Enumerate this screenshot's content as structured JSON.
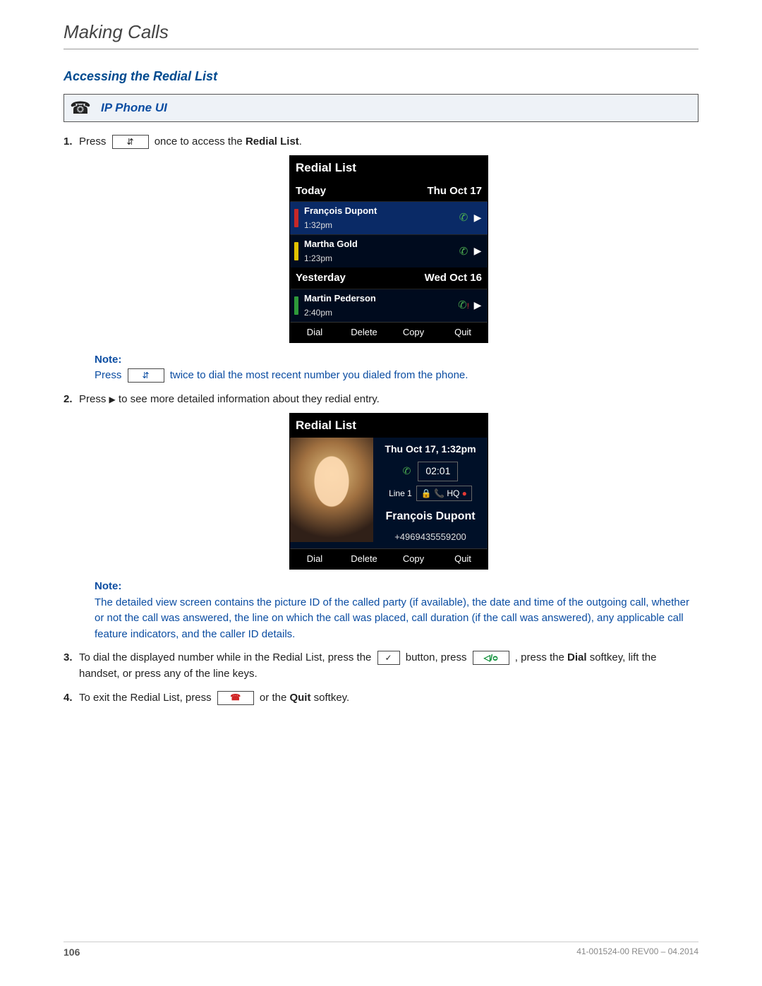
{
  "chapter": "Making Calls",
  "section": "Accessing the Redial List",
  "banner": {
    "label": "IP Phone UI"
  },
  "steps": {
    "s1": {
      "num": "1.",
      "t1": "Press",
      "t2": "once to access the ",
      "bold1": "Redial List",
      "t3": "."
    },
    "note1": {
      "label": "Note:",
      "t1": "Press",
      "t2": "twice to dial the most recent number you dialed from the phone."
    },
    "s2": {
      "num": "2.",
      "t1": "Press ",
      "t2": " to see more detailed information about they redial entry."
    },
    "note2": {
      "label": "Note:",
      "body": "The detailed view screen contains the picture ID of the called party (if available), the date and time of the outgoing call, whether or not the call was answered, the line on which the call was placed, call duration (if the call was answered), any applicable call feature indicators, and the caller ID details."
    },
    "s3": {
      "num": "3.",
      "t1": "To dial the displayed number while in the Redial List, press the ",
      "t2": " button, press ",
      "t3": " , press the ",
      "bold1": "Dial",
      "t4": " softkey, lift the handset, or press any of the line keys."
    },
    "s4": {
      "num": "4.",
      "t1": "To exit the Redial List, press ",
      "t2": " or the ",
      "bold1": "Quit",
      "t3": " softkey."
    }
  },
  "phone1": {
    "title": "Redial List",
    "groups": [
      {
        "label": "Today",
        "date": "Thu Oct 17",
        "rows": [
          {
            "name": "François Dupont",
            "time": "1:32pm",
            "bar": "red",
            "sel": true
          },
          {
            "name": "Martha Gold",
            "time": "1:23pm",
            "bar": "yellow"
          }
        ]
      },
      {
        "label": "Yesterday",
        "date": "Wed Oct 16",
        "rows": [
          {
            "name": "Martin Pederson",
            "time": "2:40pm",
            "bar": "green"
          }
        ]
      }
    ],
    "soft": [
      "Dial",
      "Delete",
      "Copy",
      "Quit"
    ]
  },
  "phone2": {
    "title": "Redial List",
    "date": "Thu Oct 17, 1:32pm",
    "duration": "02:01",
    "line": "Line 1",
    "name": "François Dupont",
    "number": "+4969435559200",
    "soft": [
      "Dial",
      "Delete",
      "Copy",
      "Quit"
    ]
  },
  "footer": {
    "page": "106",
    "rev": "41-001524-00 REV00 – 04.2014"
  }
}
